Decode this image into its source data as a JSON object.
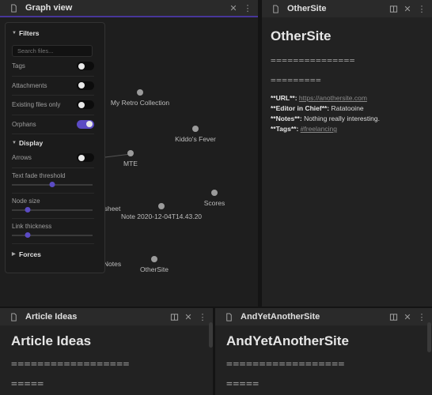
{
  "graph": {
    "title": "Graph view",
    "nodes": [
      {
        "label": "My Retro Collection"
      },
      {
        "label": "Kiddo's Fever"
      },
      {
        "label": "MTE"
      },
      {
        "label": "Scores"
      },
      {
        "label": "Note 2020-12-04T14.43.20"
      },
      {
        "label": "sheet"
      },
      {
        "label": "OtherSite"
      },
      {
        "label": "Notes"
      }
    ],
    "filters": {
      "header": "Filters",
      "search_placeholder": "Search files...",
      "tags": "Tags",
      "attachments": "Attachments",
      "existing": "Existing files only",
      "orphans": "Orphans"
    },
    "display": {
      "header": "Display",
      "arrows": "Arrows",
      "text_fade": "Text fade threshold",
      "node_size": "Node size",
      "link_thickness": "Link thickness"
    },
    "forces": {
      "header": "Forces"
    },
    "sliders": {
      "text_fade": 0.5,
      "node_size": 0.2,
      "link_thickness": 0.2
    }
  },
  "other": {
    "tab": "OtherSite",
    "title": "OtherSite",
    "eq1": "===============",
    "eq2": "=========",
    "url_key": "**URL**:",
    "url_val": "https://anothersite.com",
    "editor_key": "**Editor in Chief**:",
    "editor_val": "Ratatooine",
    "notes_key": "**Notes**:",
    "notes_val": "Nothing really interesting.",
    "tags_key": "**Tags**:",
    "tags_val": "#freelancing"
  },
  "article": {
    "tab": "Article Ideas",
    "title": "Article Ideas",
    "eq1": "==================",
    "eq2": "====="
  },
  "another": {
    "tab": "AndYetAnotherSite",
    "title": "AndYetAnotherSite",
    "eq1": "==================",
    "eq2": "====="
  },
  "colors": {
    "accent": "#5b4bc4",
    "background": "#202020"
  }
}
